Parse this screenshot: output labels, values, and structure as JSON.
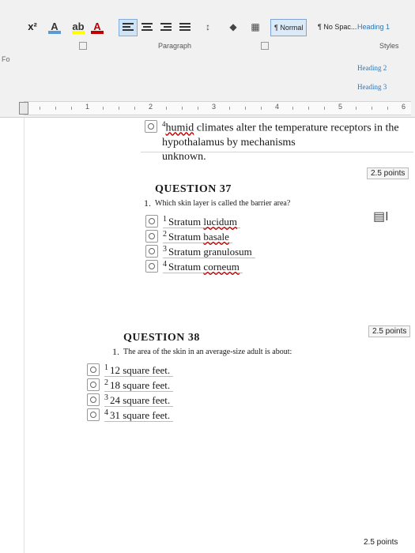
{
  "ribbon": {
    "font_buttons": [
      "x²",
      "A",
      "ab",
      "A"
    ],
    "styles": [
      "¶ Normal",
      "¶ No Spac...",
      "Heading 1",
      "Heading 2",
      "Heading 3"
    ],
    "groups": {
      "paragraph": "Paragraph",
      "styles": "Styles"
    },
    "left_stub": "Fo"
  },
  "ruler": {
    "numbers": [
      "1",
      "2",
      "3",
      "4",
      "5",
      "6"
    ]
  },
  "previous_question": {
    "choice_number": "4",
    "text_start": "humid",
    "text_rest": " climates alter the temperature receptors in the hypothalamus by mechanisms",
    "text_line2": "unknown.",
    "points": "2.5 points"
  },
  "question37": {
    "title": "QUESTION 37",
    "number": "1.",
    "prompt": "Which skin layer is called the barrier area?",
    "choices": [
      {
        "num": "1",
        "pre": "Stratum ",
        "emph": "lucidum"
      },
      {
        "num": "2",
        "pre": "Stratum ",
        "emph": "basale"
      },
      {
        "num": "3",
        "pre": "Stratum granulosum",
        "emph": ""
      },
      {
        "num": "4",
        "pre": "Stratum ",
        "emph": "corneum"
      }
    ],
    "points": "2.5 points"
  },
  "question38": {
    "title": "QUESTION 38",
    "number": "1.",
    "prompt": "The area of the skin in an average-size adult is about:",
    "choices": [
      {
        "num": "1",
        "text": "12 square feet."
      },
      {
        "num": "2",
        "text": "18 square feet."
      },
      {
        "num": "3",
        "text": "24 square feet."
      },
      {
        "num": "4",
        "text": "31 square feet."
      }
    ],
    "points": "2.5 points"
  },
  "colors": {
    "selected_style": "#dce9f7",
    "font_red": "#c00000",
    "highlight": "#ffff00"
  }
}
